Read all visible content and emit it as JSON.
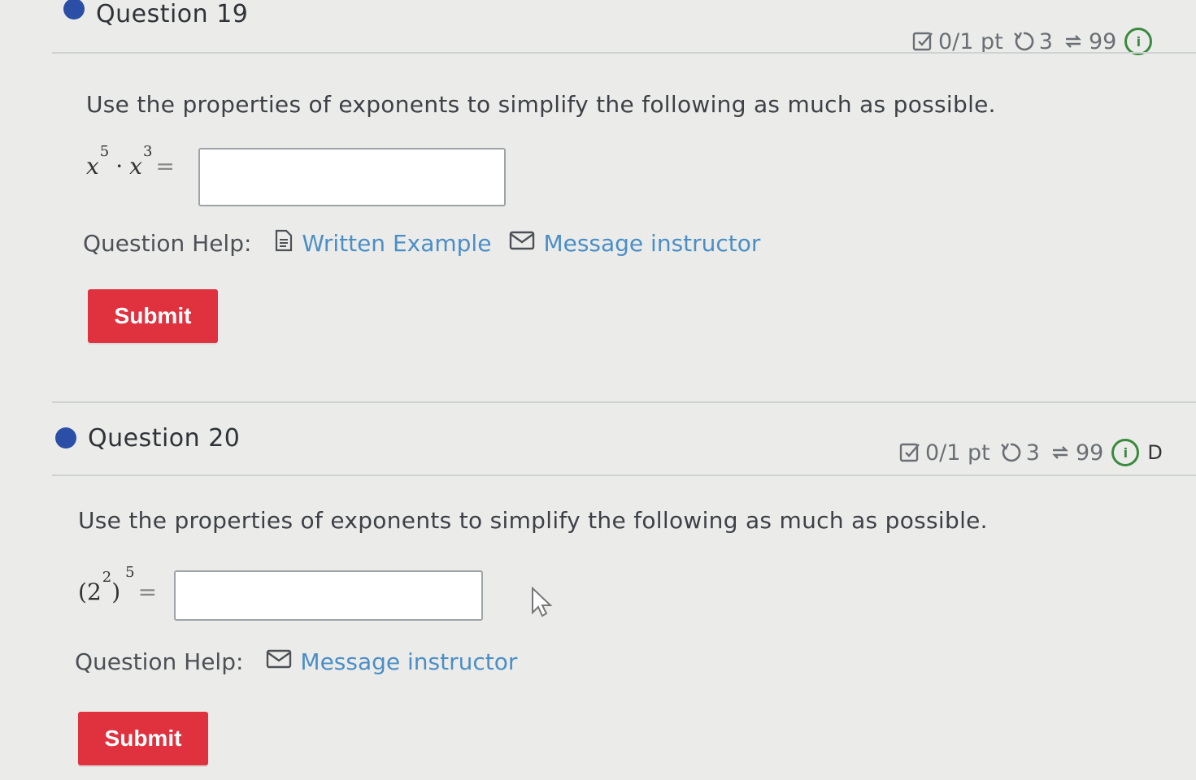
{
  "questions": [
    {
      "title": "Question 19",
      "points": "0/1 pt",
      "retries": "3",
      "attempts": "99",
      "prompt": "Use the properties of exponents to simplify the following as much as possible.",
      "expr": {
        "base1": "x",
        "exp1": "5",
        "op": "·",
        "base2": "x",
        "exp2": "3",
        "eq": "="
      },
      "answer_value": "",
      "help_label": "Question Help:",
      "help_links": [
        "Written Example",
        "Message instructor"
      ],
      "submit_label": "Submit"
    },
    {
      "title": "Question 20",
      "points": "0/1 pt",
      "retries": "3",
      "attempts": "99",
      "meta_tail": "D",
      "prompt": "Use the properties of exponents to simplify the following as much as possible.",
      "expr": {
        "open": "(",
        "base": "2",
        "inner_exp": "2",
        "close": ")",
        "outer_exp": "5",
        "eq": "="
      },
      "answer_value": "",
      "help_label": "Question Help:",
      "help_links": [
        "Message instructor"
      ],
      "submit_label": "Submit"
    }
  ],
  "colors": {
    "accent_dot": "#2b4fa6",
    "submit": "#e0313f",
    "link": "#4b8ec6",
    "info": "#3a8a3d"
  },
  "icons": {
    "points": "checkbox-pencil-icon",
    "retries": "retry-icon",
    "attempts": "refresh-arrows-icon",
    "info": "info-icon",
    "written_example": "document-icon",
    "message": "envelope-icon",
    "cursor": "mouse-pointer-icon"
  }
}
